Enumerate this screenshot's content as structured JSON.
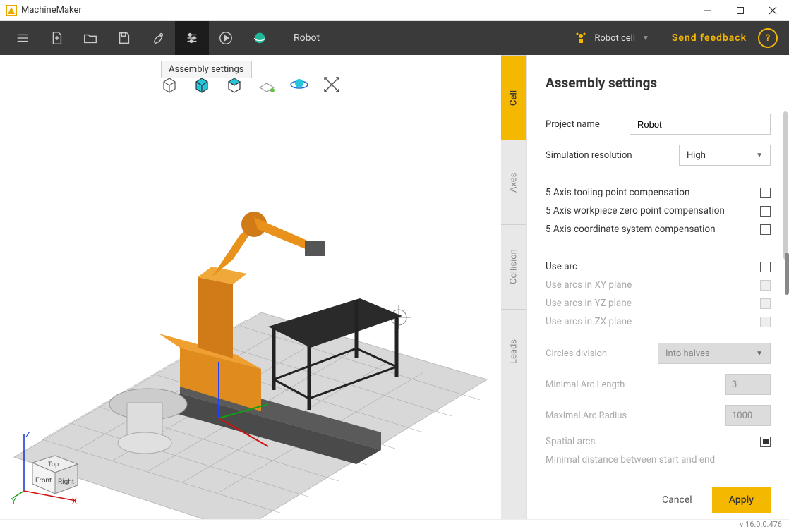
{
  "app": {
    "title": "MachineMaker"
  },
  "toolbar": {
    "current_label": "Robot",
    "cell_selector": {
      "label": "Robot cell"
    },
    "feedback": "Send feedback"
  },
  "tooltip": "Assembly settings",
  "vtabs": [
    "Cell",
    "Axes",
    "Collision",
    "Leads"
  ],
  "panel": {
    "title": "Assembly settings",
    "project_name_label": "Project name",
    "project_name_value": "Robot",
    "sim_res_label": "Simulation resolution",
    "sim_res_value": "High",
    "comp1": "5 Axis tooling point compensation",
    "comp2": "5 Axis workpiece zero point compensation",
    "comp3": "5 Axis coordinate system compensation",
    "use_arc": "Use arc",
    "arc_xy": "Use arcs in XY plane",
    "arc_yz": "Use arcs in YZ plane",
    "arc_zx": "Use arcs in ZX plane",
    "circles_div_label": "Circles division",
    "circles_div_value": "Into halves",
    "min_arc_label": "Minimal Arc Length",
    "min_arc_value": "3",
    "max_arc_label": "Maximal Arc Radius",
    "max_arc_value": "1000",
    "spatial_arcs": "Spatial arcs",
    "min_dist": "Minimal distance between start and end",
    "cancel": "Cancel",
    "apply": "Apply"
  },
  "navcube": {
    "z": "Z",
    "y": "Y",
    "x": "X",
    "top": "Top",
    "front": "Front",
    "right": "Right"
  },
  "status": {
    "version": "v 16.0.0.476"
  }
}
